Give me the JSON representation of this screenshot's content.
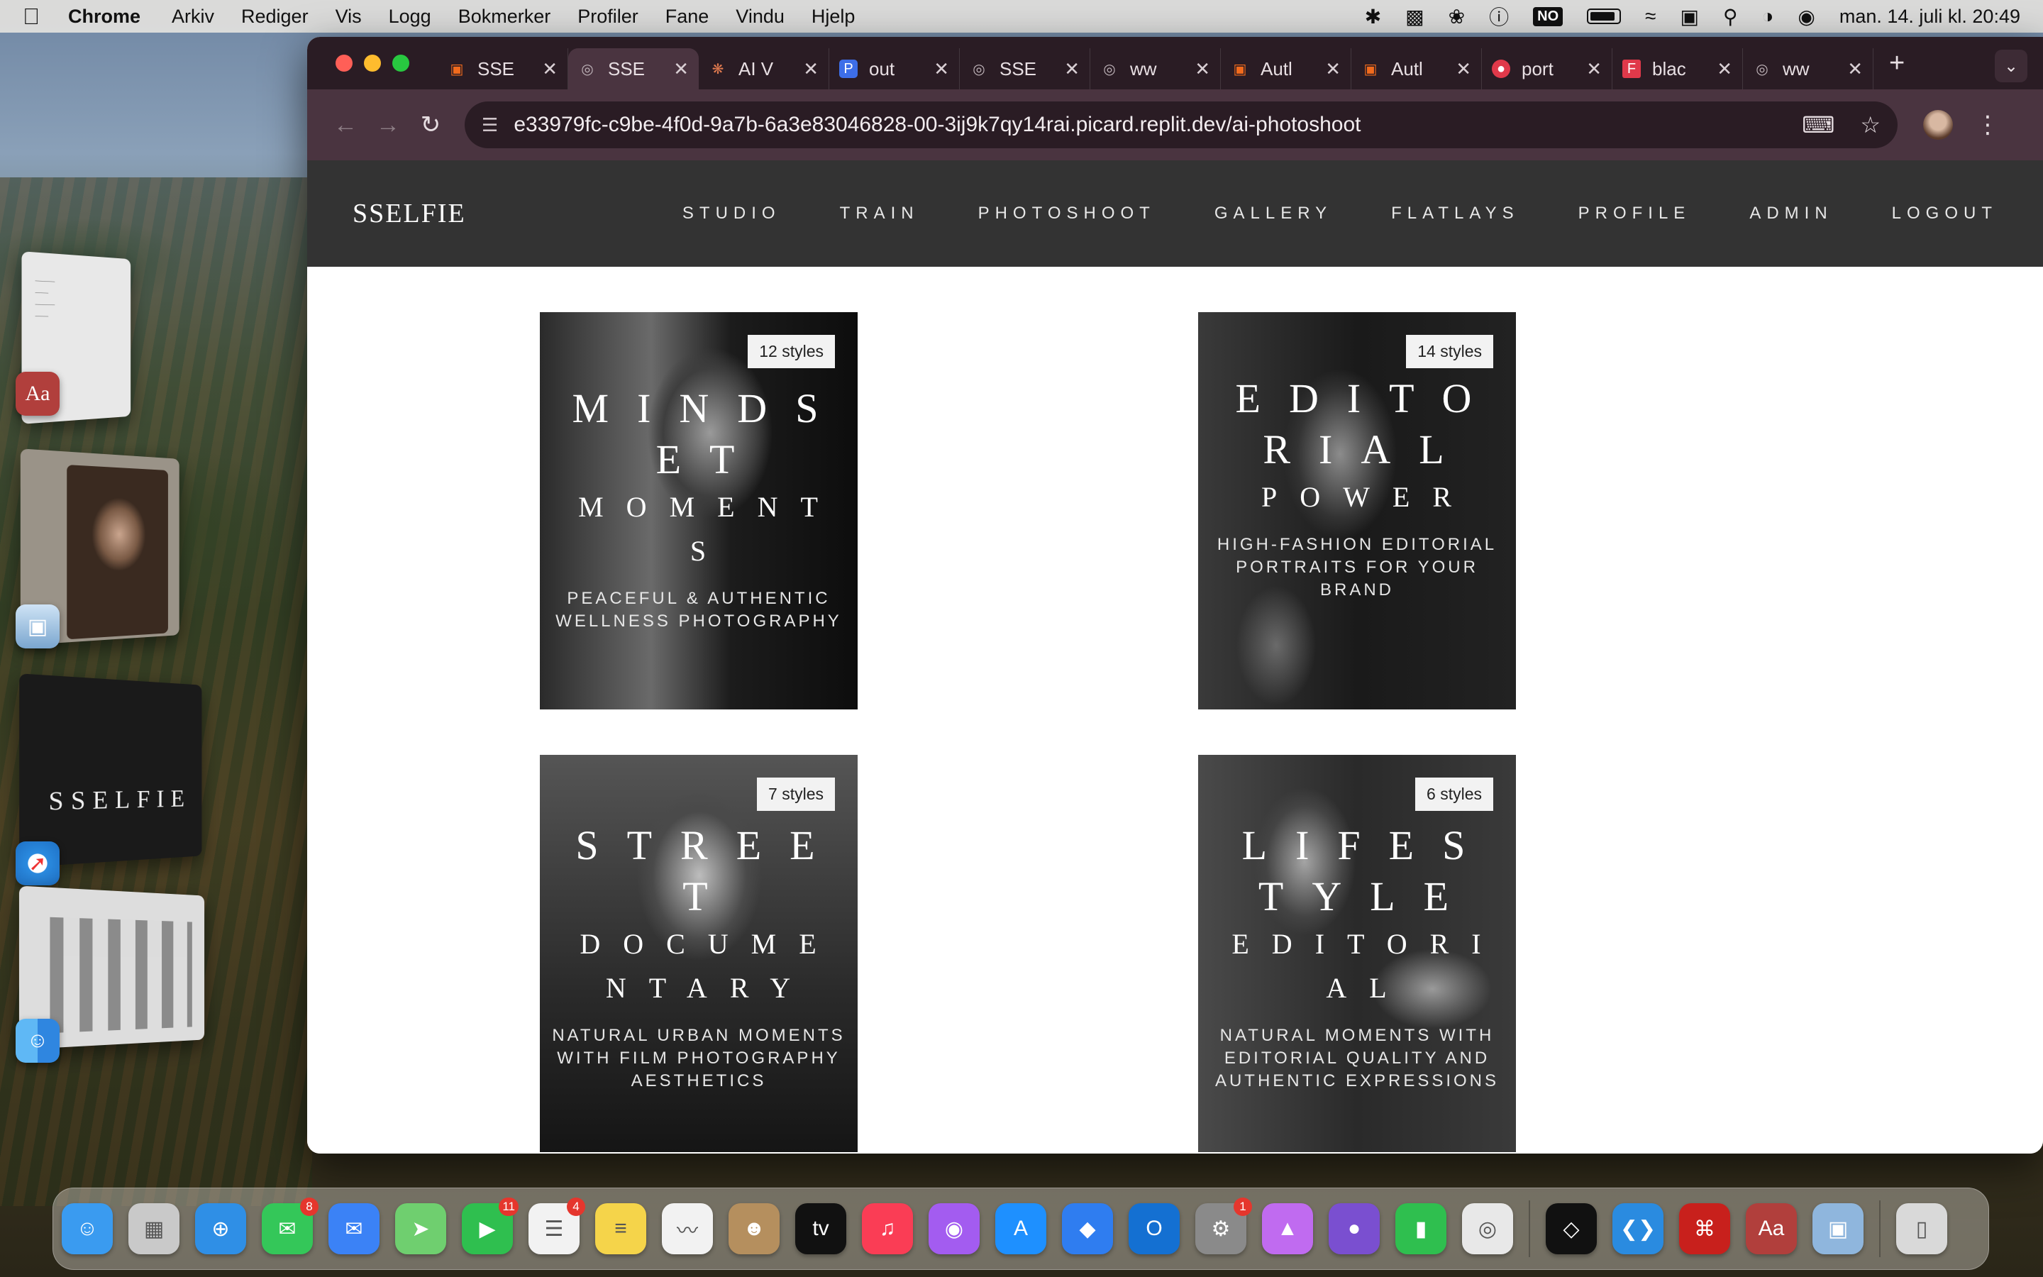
{
  "menubar": {
    "app": "Chrome",
    "items": [
      "Arkiv",
      "Rediger",
      "Vis",
      "Logg",
      "Bokmerker",
      "Profiler",
      "Fane",
      "Vindu",
      "Hjelp"
    ],
    "keyboard_layout": "NO",
    "clock": "man. 14. juli kl. 20:49"
  },
  "browser": {
    "tabs": [
      {
        "title": "SSE",
        "icon": "replit-icon"
      },
      {
        "title": "SSE",
        "icon": "globe-icon",
        "active": true
      },
      {
        "title": "AI V",
        "icon": "claude-icon"
      },
      {
        "title": "out",
        "icon": "p-icon"
      },
      {
        "title": "SSE",
        "icon": "globe-icon"
      },
      {
        "title": "ww",
        "icon": "globe-icon"
      },
      {
        "title": "Autl",
        "icon": "replit-icon"
      },
      {
        "title": "Autl",
        "icon": "replit-icon"
      },
      {
        "title": "port",
        "icon": "pinterest-icon"
      },
      {
        "title": "blac",
        "icon": "flipboard-icon"
      },
      {
        "title": "ww",
        "icon": "globe-icon"
      }
    ],
    "url": "e33979fc-c9be-4f0d-9a7b-6a3e83046828-00-3ij9k7qy14rai.picard.replit.dev/ai-photoshoot"
  },
  "site": {
    "logo": "SSELFIE",
    "nav": [
      "STUDIO",
      "TRAIN",
      "PHOTOSHOOT",
      "GALLERY",
      "FLATLAYS",
      "PROFILE",
      "ADMIN",
      "LOGOUT"
    ],
    "cards": [
      {
        "badge": "12 styles",
        "title": "MINDSET",
        "subtitle": "MOMENTS",
        "desc": "PEACEFUL & AUTHENTIC WELLNESS PHOTOGRAPHY"
      },
      {
        "badge": "14 styles",
        "title": "EDITORIAL",
        "subtitle": "POWER",
        "desc": "HIGH-FASHION EDITORIAL PORTRAITS FOR YOUR BRAND"
      },
      {
        "badge": "7 styles",
        "title": "STREET",
        "subtitle": "DOCUMENTARY",
        "desc": "NATURAL URBAN MOMENTS WITH FILM PHOTOGRAPHY AESTHETICS"
      },
      {
        "badge": "6 styles",
        "title": "LIFESTYLE",
        "subtitle": "EDITORIAL",
        "desc": "NATURAL MOMENTS WITH EDITORIAL QUALITY AND AUTHENTIC EXPRESSIONS"
      }
    ]
  },
  "desktop": {
    "stage_thumb_3_text": "SSELFIE",
    "side_dict_label": "Aa"
  },
  "dock": {
    "apps": [
      {
        "name": "finder-icon",
        "color": "#3a9bf0"
      },
      {
        "name": "launchpad-icon",
        "color": "#c9c9c9"
      },
      {
        "name": "safari-icon",
        "color": "#2f8fe6"
      },
      {
        "name": "messages-icon",
        "color": "#34c759",
        "badge": "8"
      },
      {
        "name": "mail-icon",
        "color": "#3b82f6"
      },
      {
        "name": "maps-icon",
        "color": "#6fcf6f"
      },
      {
        "name": "facetime-icon",
        "color": "#2fbf4f",
        "badge": "11"
      },
      {
        "name": "reminders-icon",
        "color": "#f2f2f2",
        "badge": "4"
      },
      {
        "name": "notes-icon",
        "color": "#f5d44a"
      },
      {
        "name": "freeform-icon",
        "color": "#f2f2f2"
      },
      {
        "name": "contacts-icon",
        "color": "#b58f5e"
      },
      {
        "name": "appletv-icon",
        "color": "#111111"
      },
      {
        "name": "music-icon",
        "color": "#fa3d55"
      },
      {
        "name": "podcasts-icon",
        "color": "#a35cf0"
      },
      {
        "name": "appstore-icon",
        "color": "#1e90ff"
      },
      {
        "name": "roblox-icon",
        "color": "#2f7df0"
      },
      {
        "name": "outlook-icon",
        "color": "#1470d2"
      },
      {
        "name": "settings-icon",
        "color": "#8a8a8a",
        "badge": "1"
      },
      {
        "name": "keynote-icon",
        "color": "#c06bf0"
      },
      {
        "name": "github-icon",
        "color": "#7a4fd0"
      },
      {
        "name": "numbers-icon",
        "color": "#2fbf4f"
      },
      {
        "name": "chrome-icon",
        "color": "#e8e8e8"
      },
      {
        "name": "unity-icon",
        "color": "#111111"
      },
      {
        "name": "vscode-icon",
        "color": "#2a8be0"
      },
      {
        "name": "acrobat-icon",
        "color": "#c8201c"
      },
      {
        "name": "dictionary-icon",
        "color": "#b13f3c",
        "label": "Aa"
      },
      {
        "name": "preview-icon",
        "color": "#8fb6dd"
      },
      {
        "name": "trash-icon",
        "color": "#d9d9d9"
      }
    ]
  }
}
